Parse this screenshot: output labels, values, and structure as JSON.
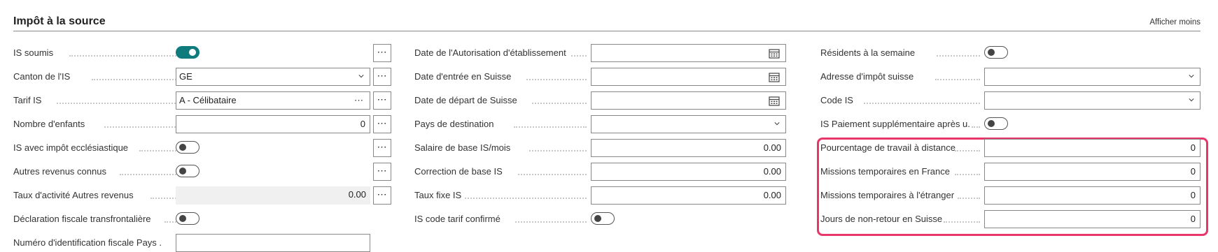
{
  "section": {
    "title": "Impôt à la source",
    "toggle_link": "Afficher moins"
  },
  "col1": {
    "is_soumis": {
      "label": "IS soumis",
      "on": true
    },
    "canton": {
      "label": "Canton de l'IS",
      "value": "GE"
    },
    "tarif": {
      "label": "Tarif IS",
      "value": "A - Célibataire"
    },
    "enfants": {
      "label": "Nombre d'enfants",
      "value": "0"
    },
    "eccl": {
      "label": "IS avec impôt ecclésiastique",
      "on": false
    },
    "autres": {
      "label": "Autres revenus connus",
      "on": false
    },
    "taux": {
      "label": "Taux d'activité Autres revenus",
      "value": "0.00"
    },
    "decl": {
      "label": "Déclaration fiscale transfrontalière",
      "on": false
    },
    "numero": {
      "label": "Numéro d'identification fiscale Pays ...",
      "value": ""
    }
  },
  "col2": {
    "autorisation": {
      "label": "Date de l'Autorisation d'établissement",
      "value": ""
    },
    "entree": {
      "label": "Date d'entrée en Suisse",
      "value": ""
    },
    "depart": {
      "label": "Date de départ de Suisse",
      "value": ""
    },
    "pays": {
      "label": "Pays de destination",
      "value": ""
    },
    "salaire": {
      "label": "Salaire de base IS/mois",
      "value": "0.00"
    },
    "correction": {
      "label": "Correction de base IS",
      "value": "0.00"
    },
    "taux_fixe": {
      "label": "Taux fixe IS",
      "value": "0.00"
    },
    "code_tarif": {
      "label": "IS code tarif confirmé",
      "on": false
    }
  },
  "col3": {
    "residents": {
      "label": "Résidents à la semaine",
      "on": false
    },
    "adresse": {
      "label": "Adresse d'impôt suisse",
      "value": ""
    },
    "code_is": {
      "label": "Code IS",
      "value": ""
    },
    "paiement": {
      "label": "IS Paiement supplémentaire après u...",
      "on": false
    },
    "pourcentage": {
      "label": "Pourcentage de travail à distance",
      "value": "0"
    },
    "france": {
      "label": "Missions temporaires en France",
      "value": "0"
    },
    "etranger": {
      "label": "Missions temporaires à l'étranger",
      "value": "0"
    },
    "jours": {
      "label": "Jours de non-retour en Suisse",
      "value": "0"
    }
  },
  "colors": {
    "accent": "#0f7b7c",
    "highlight": "#e8356a"
  },
  "icons": {
    "ellipsis": "⋯",
    "dropdown": "chevron-down-icon",
    "calendar": "calendar-icon"
  }
}
